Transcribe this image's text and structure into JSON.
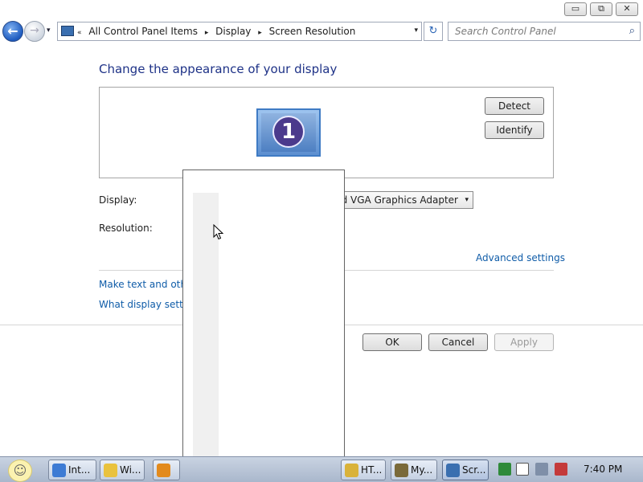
{
  "window": {
    "controls": {
      "minimize": "▭",
      "maximize": "⧉",
      "close": "✕"
    }
  },
  "nav": {
    "back_glyph": "←",
    "forward_glyph": "→",
    "history_glyph": "▾",
    "address": {
      "overflow": "«",
      "crumbs": [
        "All Control Panel Items",
        "Display",
        "Screen Resolution"
      ],
      "separator": "▸",
      "chevron": "▾"
    },
    "refresh_glyph": "↻",
    "search": {
      "placeholder": "Search Control Panel",
      "icon_glyph": "⌕"
    }
  },
  "main": {
    "heading": "Change the appearance of your display",
    "monitor_number": "1",
    "detect_label": "Detect",
    "identify_label": "Identify",
    "display_label": "Display:",
    "display_value": "dard VGA Graphics Adapter",
    "display_chevron": "▾",
    "resolution_label": "Resolution:",
    "advanced_link": "Advanced settings",
    "text_link": "Make text and other",
    "what_link": "What display setting"
  },
  "actions": {
    "ok_label": "OK",
    "cancel_label": "Cancel",
    "apply_label": "Apply"
  },
  "taskbar": {
    "start_glyph": "☺",
    "tasks": [
      {
        "label": "Int...",
        "icon_color": "#3d7bd4"
      },
      {
        "label": "Wi...",
        "icon_color": "#e9c23e"
      },
      {
        "label": "",
        "icon_color": "#e28a1d"
      },
      {
        "label": "HT...",
        "icon_color": "#d9b23a"
      },
      {
        "label": "My...",
        "icon_color": "#7a6a3a"
      },
      {
        "label": "Scr...",
        "icon_color": "#3a6fb0"
      }
    ],
    "clock": "7:40 PM"
  }
}
